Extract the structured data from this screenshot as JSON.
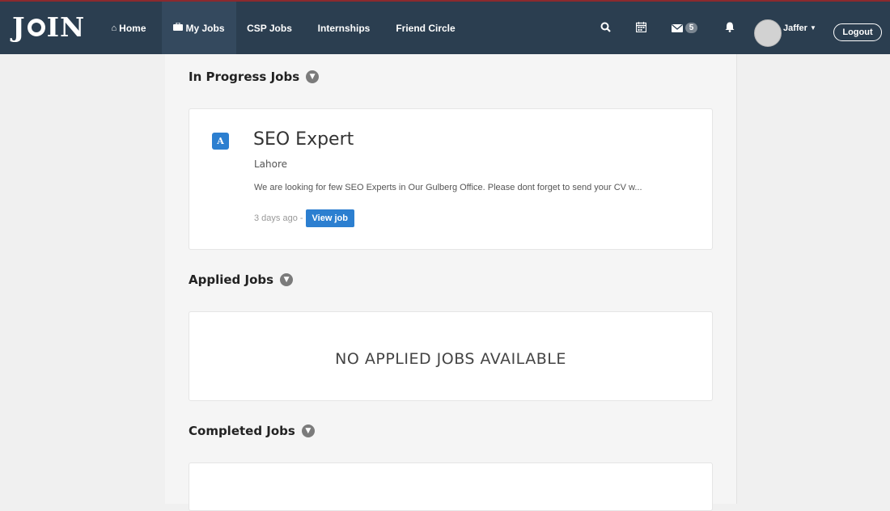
{
  "brand": {
    "logo_text_left": "J",
    "logo_text_right": "IN"
  },
  "nav": {
    "home": "Home",
    "my_jobs": "My Jobs",
    "csp_jobs": "CSP Jobs",
    "internships": "Internships",
    "friend_circle": "Friend Circle"
  },
  "header": {
    "messages_count": "5",
    "user_name": "Jaffer",
    "logout_label": "Logout"
  },
  "icons": {
    "home": "home-icon",
    "my_jobs": "briefcase-icon",
    "search": "search-icon",
    "calendar": "calendar-icon",
    "messages": "envelope-icon",
    "notifications": "bell-icon"
  },
  "sections": {
    "in_progress": {
      "title": "In Progress Jobs",
      "jobs": [
        {
          "title": "SEO Expert",
          "location": "Lahore",
          "description": "We are looking for few SEO Experts in Our Gulberg Office. Please dont forget to send your CV w...",
          "posted": "3 days ago -",
          "view_label": "View job",
          "logo_letter": "A"
        }
      ]
    },
    "applied": {
      "title": "Applied Jobs",
      "empty_message": "NO APPLIED JOBS AVAILABLE"
    },
    "completed": {
      "title": "Completed Jobs"
    }
  },
  "colors": {
    "navbar": "#2b3e50",
    "navbar_active": "#34495e",
    "accent": "#2c7fd0",
    "top_border": "#8b2a2e"
  }
}
